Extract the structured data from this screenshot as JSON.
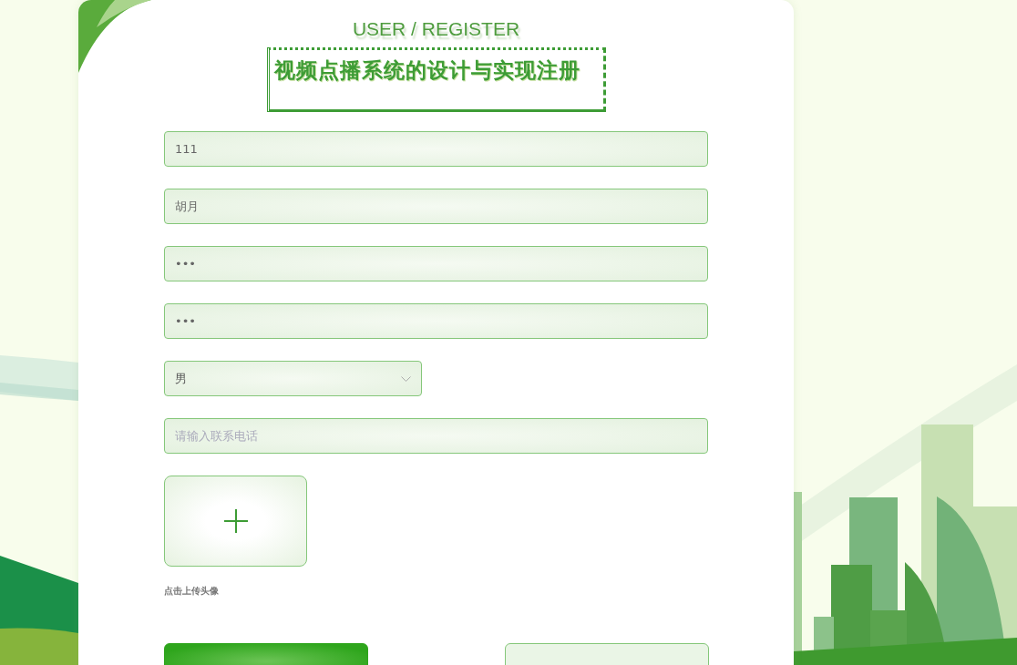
{
  "header": {
    "subtitle": "USER / REGISTER",
    "title": "视频点播系统的设计与实现注册"
  },
  "fields": [
    {
      "kind": "input",
      "value": "111"
    },
    {
      "kind": "input",
      "value": "胡月"
    },
    {
      "kind": "input",
      "value": "•••"
    },
    {
      "kind": "input",
      "value": "•••"
    },
    {
      "kind": "select",
      "value": "男"
    },
    {
      "kind": "input",
      "placeholder": "请输入联系电话"
    }
  ],
  "avatar_upload": {
    "hint": "点击上传头像"
  },
  "buttons": [
    {
      "kind": "primary"
    },
    {
      "kind": "secondary"
    }
  ]
}
